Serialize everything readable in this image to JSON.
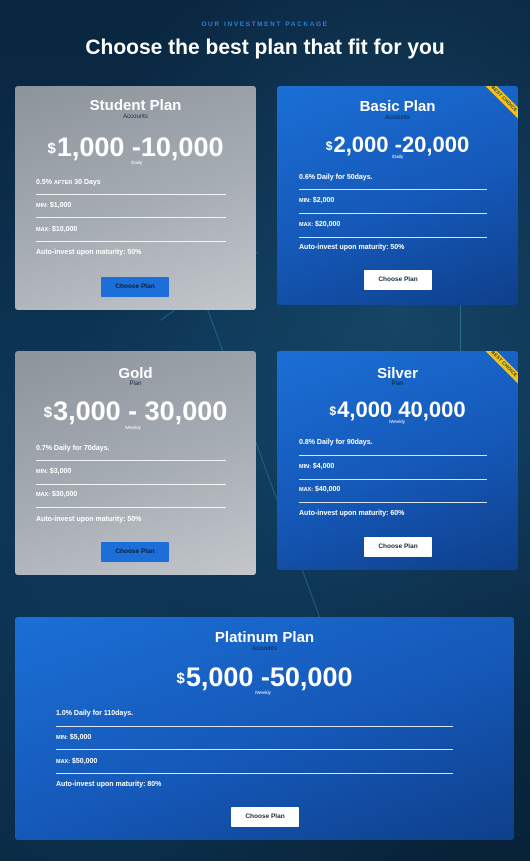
{
  "header": {
    "eyebrow": "OUR INVESTMENT PACKAGE",
    "title": "Choose the best plan that fit for you"
  },
  "plans": [
    {
      "name": "Student Plan",
      "subtitle": "Accounts",
      "currency": "$",
      "price": "1,000 -10,000",
      "period": "/Daily",
      "features": [
        {
          "prefix": "0.5%",
          "small": "AFTER",
          "suffix": "30 Days"
        },
        {
          "prefix": "",
          "small": "MIN:",
          "suffix": "$1,000"
        },
        {
          "prefix": "",
          "small": "MAX:",
          "suffix": "$10,000"
        },
        {
          "prefix": "Auto-invest upon maturity: 50%",
          "small": "",
          "suffix": ""
        }
      ],
      "button": "Choose Plan",
      "badge": ""
    },
    {
      "name": "Basic Plan",
      "subtitle": "Accounts",
      "currency": "$",
      "price": "2,000 -20,000",
      "period": "/Daily",
      "features": [
        {
          "prefix": "0.6% Daily for 50days.",
          "small": "",
          "suffix": ""
        },
        {
          "prefix": "",
          "small": "MIN:",
          "suffix": "$2,000"
        },
        {
          "prefix": "",
          "small": "MAX:",
          "suffix": "$20,000"
        },
        {
          "prefix": "Auto-invest upon maturity: 50%",
          "small": "",
          "suffix": ""
        }
      ],
      "button": "Choose Plan",
      "badge": "BEST CHOICE"
    },
    {
      "name": "Gold",
      "subtitle": "Plan",
      "currency": "$",
      "price": "3,000 - 30,000",
      "period": "/Weekly",
      "features": [
        {
          "prefix": "0.7% Daily for 70days.",
          "small": "",
          "suffix": ""
        },
        {
          "prefix": "",
          "small": "MIN:",
          "suffix": "$3,000"
        },
        {
          "prefix": "",
          "small": "MAX:",
          "suffix": "$30,000"
        },
        {
          "prefix": "Auto-invest upon maturity: 50%",
          "small": "",
          "suffix": ""
        }
      ],
      "button": "Choose Plan",
      "badge": ""
    },
    {
      "name": "Silver",
      "subtitle": "Plan",
      "currency": "$",
      "price": "4,000 40,000",
      "period": "/Weekly",
      "features": [
        {
          "prefix": "0.8% Daily for 90days.",
          "small": "",
          "suffix": ""
        },
        {
          "prefix": "",
          "small": "MIN:",
          "suffix": "$4,000"
        },
        {
          "prefix": "",
          "small": "MAX:",
          "suffix": "$40,000"
        },
        {
          "prefix": "Auto-invest upon maturity: 60%",
          "small": "",
          "suffix": ""
        }
      ],
      "button": "Choose Plan",
      "badge": "BEST CHOICE"
    },
    {
      "name": "Platinum Plan",
      "subtitle": "Accounts",
      "currency": "$",
      "price": "5,000 -50,000",
      "period": "/Weekly",
      "features": [
        {
          "prefix": "1.0% Daily for 110days.",
          "small": "",
          "suffix": ""
        },
        {
          "prefix": "",
          "small": "MIN:",
          "suffix": "$5,000"
        },
        {
          "prefix": "",
          "small": "MAX:",
          "suffix": "$50,000"
        },
        {
          "prefix": "Auto-invest upon maturity: 80%",
          "small": "",
          "suffix": ""
        }
      ],
      "button": "Choose Plan",
      "badge": ""
    }
  ],
  "colors": {
    "accent": "#1c6fd8",
    "badge": "#f3c316",
    "eyebrow": "#2f7fd8"
  }
}
